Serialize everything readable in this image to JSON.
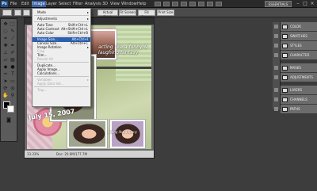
{
  "app": {
    "logo": "Ps",
    "menus": [
      "File",
      "Edit",
      "Image",
      "Layer",
      "Select",
      "Filter",
      "Analysis",
      "3D",
      "View",
      "Window",
      "Help"
    ],
    "workspace": "ESSENTIALS",
    "window_controls": [
      "–",
      "□",
      "×"
    ]
  },
  "options_bar": {
    "buttons": [
      "Actual Pixels",
      "Fit Screen",
      "Fill Screen",
      "Print Size"
    ]
  },
  "image_menu": {
    "items": [
      {
        "label": "Mode",
        "shortcut": "",
        "submenu": true,
        "disabled": false
      },
      {
        "sep": true
      },
      {
        "label": "Adjustments",
        "shortcut": "",
        "submenu": true,
        "disabled": false
      },
      {
        "sep": true
      },
      {
        "label": "Auto Tone",
        "shortcut": "Shift+Ctrl+L",
        "disabled": false
      },
      {
        "label": "Auto Contrast",
        "shortcut": "Alt+Shift+Ctrl+L",
        "disabled": false
      },
      {
        "label": "Auto Color",
        "shortcut": "Shift+Ctrl+B",
        "disabled": false
      },
      {
        "sep": true
      },
      {
        "label": "Image Size...",
        "shortcut": "Alt+Ctrl+I",
        "highlight": true,
        "disabled": false
      },
      {
        "label": "Canvas Size...",
        "shortcut": "Alt+Ctrl+C",
        "disabled": false
      },
      {
        "label": "Image Rotation",
        "shortcut": "",
        "submenu": true,
        "disabled": false
      },
      {
        "label": "Crop",
        "shortcut": "",
        "disabled": true
      },
      {
        "label": "Trim...",
        "shortcut": "",
        "disabled": false
      },
      {
        "label": "Reveal All",
        "shortcut": "",
        "disabled": true
      },
      {
        "sep": true
      },
      {
        "label": "Duplicate...",
        "shortcut": "",
        "disabled": false
      },
      {
        "label": "Apply Image...",
        "shortcut": "",
        "disabled": false
      },
      {
        "label": "Calculations...",
        "shortcut": "",
        "disabled": false
      },
      {
        "sep": true
      },
      {
        "label": "Variables",
        "shortcut": "",
        "submenu": true,
        "disabled": true
      },
      {
        "label": "Apply Data Set...",
        "shortcut": "",
        "disabled": true
      },
      {
        "sep": true
      },
      {
        "label": "Trap...",
        "shortcut": "",
        "disabled": true
      }
    ]
  },
  "document": {
    "tab_title": "",
    "zoom": "33.33%",
    "doc_size": "Doc: 20.6M/177.7M",
    "captions": {
      "top": "acting like a funny & laughing fantasy",
      "bottom": "acting like a funny",
      "date": "July 15, 2007"
    }
  },
  "panels": {
    "group1": [
      {
        "label": "COLOR",
        "icon": "color-icon"
      },
      {
        "label": "SWATCHES",
        "icon": "swatches-icon"
      },
      {
        "label": "STYLES",
        "icon": "styles-icon"
      },
      {
        "label": "CHARACTER",
        "icon": "character-icon"
      }
    ],
    "group2": [
      {
        "label": "MASKS",
        "icon": "masks-icon"
      },
      {
        "label": "ADJUSTMENTS",
        "icon": "adjustments-icon"
      }
    ],
    "group3": [
      {
        "label": "LAYERS",
        "icon": "layers-icon"
      },
      {
        "label": "CHANNELS",
        "icon": "channels-icon"
      },
      {
        "label": "PATHS",
        "icon": "paths-icon"
      }
    ]
  },
  "colors": {
    "menu_highlight": "#2d5fb0",
    "canvas_green": "#b8c79b",
    "panel_bg": "#595959"
  }
}
